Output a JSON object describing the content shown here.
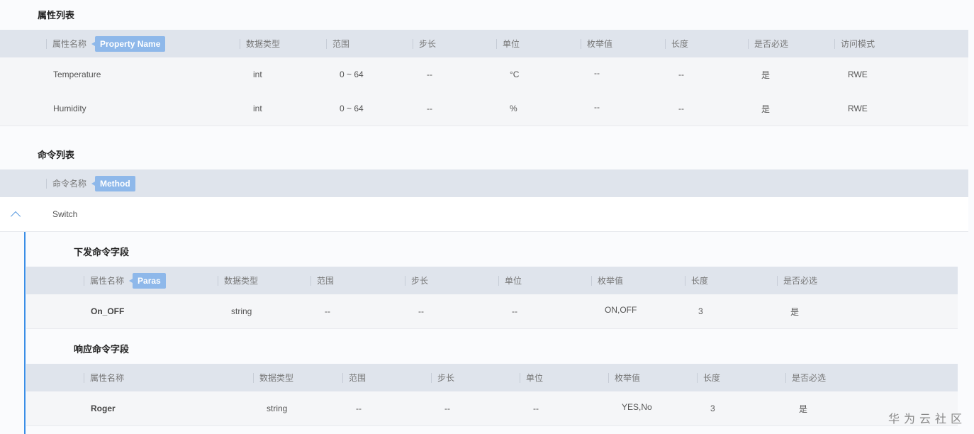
{
  "property_list": {
    "title": "属性列表",
    "columns": [
      "属性名称",
      "数据类型",
      "范围",
      "步长",
      "单位",
      "枚举值",
      "长度",
      "是否必选",
      "访问模式"
    ],
    "tag": "Property Name",
    "rows": [
      [
        "Temperature",
        "int",
        "0 ~ 64",
        "--",
        "°C",
        "--",
        "--",
        "是",
        "RWE"
      ],
      [
        "Humidity",
        "int",
        "0 ~ 64",
        "--",
        "%",
        "--",
        "--",
        "是",
        "RWE"
      ]
    ]
  },
  "command_list": {
    "title": "命令列表",
    "column": "命令名称",
    "tag": "Method",
    "command": "Switch",
    "collapse_icon": "chevron-up-icon"
  },
  "send_fields": {
    "title": "下发命令字段",
    "columns": [
      "属性名称",
      "数据类型",
      "范围",
      "步长",
      "单位",
      "枚举值",
      "长度",
      "是否必选"
    ],
    "tag": "Paras",
    "rows": [
      [
        "On_OFF",
        "string",
        "--",
        "--",
        "--",
        "ON,OFF",
        "3",
        "是"
      ]
    ]
  },
  "response_fields": {
    "title": "响应命令字段",
    "columns": [
      "属性名称",
      "数据类型",
      "范围",
      "步长",
      "单位",
      "枚举值",
      "长度",
      "是否必选"
    ],
    "rows": [
      [
        "Roger",
        "string",
        "--",
        "--",
        "--",
        "YES,No",
        "3",
        "是"
      ]
    ]
  },
  "watermark": "华为云社区",
  "colors": {
    "header_bg": "#dfe4ec",
    "tag_bg": "#8eb8ea",
    "accent": "#3a8ee6"
  }
}
